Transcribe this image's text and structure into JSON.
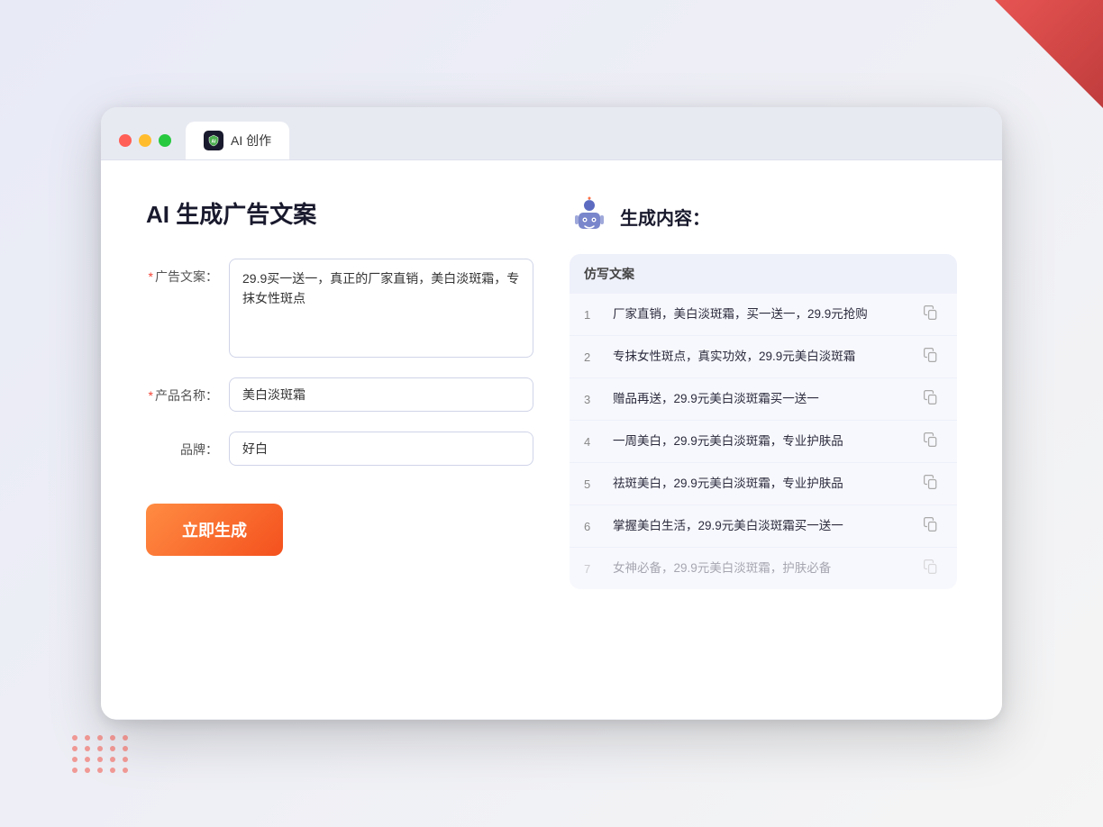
{
  "window": {
    "tab_label": "AI 创作",
    "tab_icon": "AI"
  },
  "left_panel": {
    "page_title": "AI 生成广告文案",
    "fields": [
      {
        "label": "广告文案：",
        "required": true,
        "type": "textarea",
        "value": "29.9买一送一，真正的厂家直销，美白淡斑霜，专抹女性斑点",
        "placeholder": ""
      },
      {
        "label": "产品名称：",
        "required": true,
        "type": "input",
        "value": "美白淡斑霜",
        "placeholder": ""
      },
      {
        "label": "品牌：",
        "required": false,
        "type": "input",
        "value": "好白",
        "placeholder": ""
      }
    ],
    "generate_button": "立即生成"
  },
  "right_panel": {
    "title": "生成内容：",
    "table_header": "仿写文案",
    "results": [
      {
        "num": 1,
        "text": "厂家直销，美白淡斑霜，买一送一，29.9元抢购",
        "faded": false
      },
      {
        "num": 2,
        "text": "专抹女性斑点，真实功效，29.9元美白淡斑霜",
        "faded": false
      },
      {
        "num": 3,
        "text": "赠品再送，29.9元美白淡斑霜买一送一",
        "faded": false
      },
      {
        "num": 4,
        "text": "一周美白，29.9元美白淡斑霜，专业护肤品",
        "faded": false
      },
      {
        "num": 5,
        "text": "祛斑美白，29.9元美白淡斑霜，专业护肤品",
        "faded": false
      },
      {
        "num": 6,
        "text": "掌握美白生活，29.9元美白淡斑霜买一送一",
        "faded": false
      },
      {
        "num": 7,
        "text": "女神必备，29.9元美白淡斑霜，护肤必备",
        "faded": true
      }
    ]
  },
  "colors": {
    "accent": "#f4511e",
    "brand": "#5c6bc0"
  }
}
